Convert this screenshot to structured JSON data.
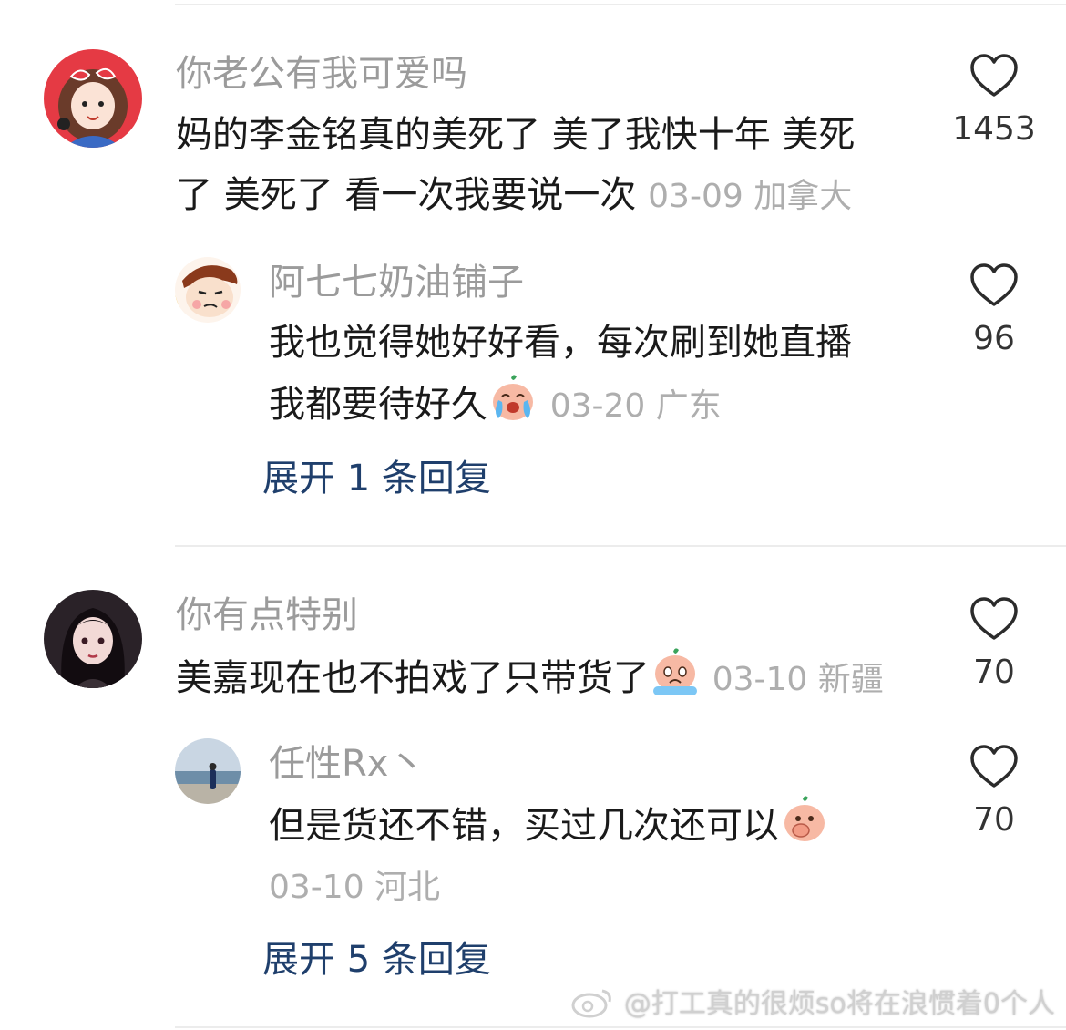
{
  "comments": [
    {
      "username": "你老公有我可爱吗",
      "text_line1": "妈的李金铭真的美死了 美了我快十年 美死",
      "text_line2": "了 美死了 看一次我要说一次",
      "meta": "03-09 加拿大",
      "likes": "1453",
      "avatar_icon": "cartoon-girl-avatar-icon",
      "replies": [
        {
          "username": "阿七七奶油铺子",
          "text_line1": "我也觉得她好好看，每次刷到她直播",
          "text_line2": "我都要待好久",
          "emoji_icon": "crying-face-emoji-icon",
          "meta": "03-20 广东",
          "likes": "96",
          "avatar_icon": "cartoon-face-avatar-icon"
        }
      ],
      "expand_label": "展开 1 条回复"
    },
    {
      "username": "你有点特别",
      "text_line1": "美嘉现在也不拍戏了只带货了",
      "emoji_icon": "tearful-face-emoji-icon",
      "meta": "03-10 新疆",
      "likes": "70",
      "avatar_icon": "dark-haired-girl-avatar-icon",
      "replies": [
        {
          "username": "任性Rx丶",
          "text_line1": "但是货还不错，买过几次还可以",
          "emoji_icon": "hand-over-mouth-emoji-icon",
          "meta": "03-10 河北",
          "likes": "70",
          "avatar_icon": "beach-photo-avatar-icon"
        }
      ],
      "expand_label": "展开 5 条回复"
    }
  ],
  "watermark": "@打工真的很烦so将在浪惯着0个人",
  "colors": {
    "username": "#9b9b9b",
    "text": "#1a1a1a",
    "meta": "#aeaeae",
    "expand": "#1f3f6c"
  }
}
